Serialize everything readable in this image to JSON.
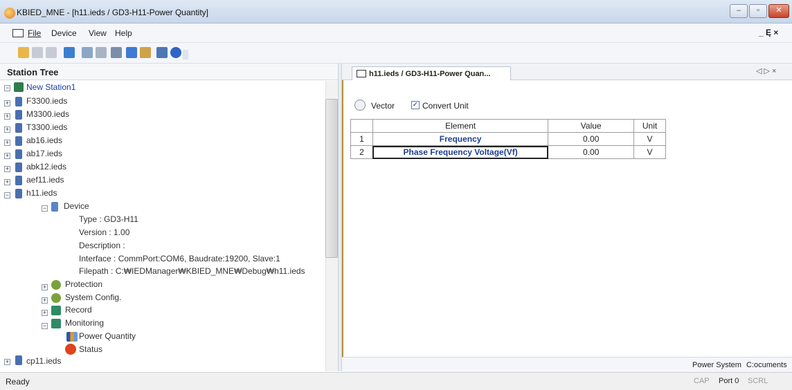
{
  "window": {
    "title": "KBIED_MNE - [h11.ieds / GD3-H11-Power Quantity]",
    "controls": {
      "minimize": "–",
      "restore": "▫",
      "close": "✕"
    },
    "mdi_controls": "_ Ę ×"
  },
  "menu": {
    "items": [
      "File",
      "Device",
      "View",
      "Help"
    ]
  },
  "toolbar": {
    "icons": [
      "open-folder-icon",
      "save-icon",
      "save-all-icon",
      "tree-icon",
      "connect-icon",
      "disconnect-icon",
      "settings-icon",
      "monitor-icon",
      "table-icon",
      "window-icon",
      "help-icon"
    ]
  },
  "station_tree": {
    "title": "Station Tree",
    "root": "New Station1",
    "files_before": [
      "F3300.ieds",
      "M3300.ieds",
      "T3300.ieds",
      "ab16.ieds",
      "ab17.ieds",
      "abk12.ieds",
      "aef11.ieds",
      "h11.ieds"
    ],
    "device": {
      "label": "Device",
      "type": "Type : GD3-H11",
      "version": "Version : 1.00",
      "description": "Description :",
      "interface": "Interface : CommPort:COM6, Baudrate:19200, Slave:1",
      "filepath": "Filepath : C:₩IEDManager₩KBIED_MNE₩Debug₩h11.ieds"
    },
    "groups": [
      "Protection",
      "System Config.",
      "Record",
      "Monitoring"
    ],
    "monitoring_items": [
      "Power Quantity",
      "Status"
    ],
    "after": "cp11.ieds"
  },
  "document": {
    "tab_label": "h11.ieds / GD3-H11-Power Quan...",
    "tab_nav": "◁ ▷ ×",
    "vector_label": "Vector",
    "convert_unit_label": "Convert Unit",
    "convert_unit_checked": true,
    "table": {
      "headers": [
        "",
        "Element",
        "Value",
        "Unit"
      ],
      "rows": [
        {
          "index": "1",
          "element": "Frequency",
          "value": "0.00",
          "unit": "V"
        },
        {
          "index": "2",
          "element": "Phase Frequency Voltage(Vf)",
          "value": "0.00",
          "unit": "V"
        }
      ]
    },
    "footer": {
      "power_system": "Power System",
      "path": "C:ocuments"
    }
  },
  "statusbar": {
    "status": "Ready",
    "cap": "CAP",
    "port": "Port 0",
    "scrl": "SCRL"
  },
  "colors": {
    "accent_blue": "#1f3d8f",
    "frame_gold": "#b98f3a"
  }
}
